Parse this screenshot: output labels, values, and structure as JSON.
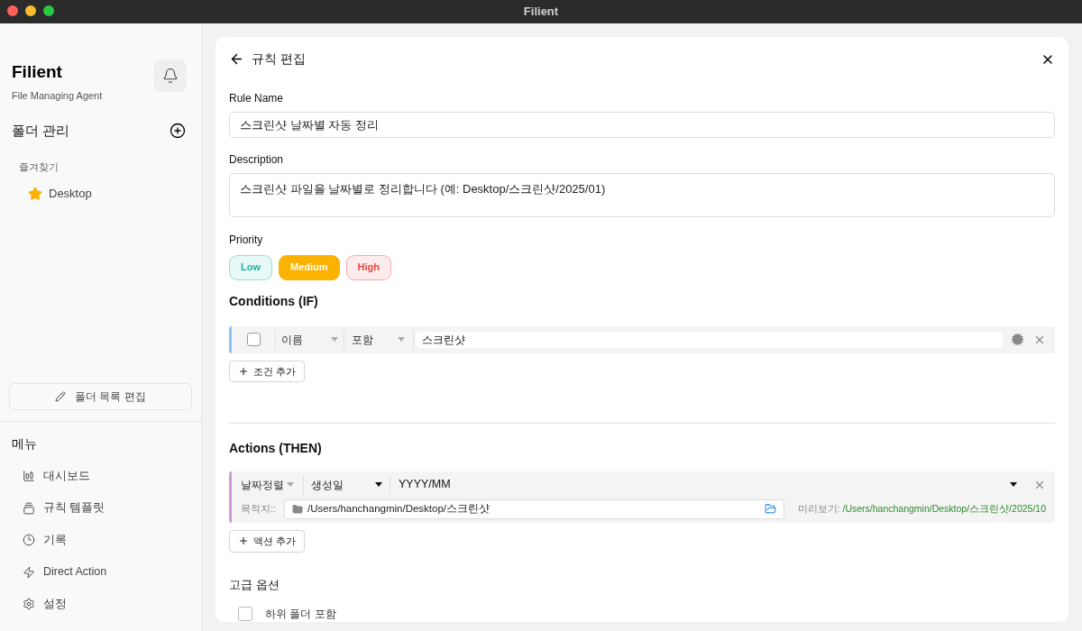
{
  "window": {
    "title": "Filient"
  },
  "sidebar": {
    "app_name": "Filient",
    "app_subtitle": "File Managing Agent",
    "folders_title": "폴더 관리",
    "favorites_title": "즐겨찾기",
    "favorites": [
      {
        "label": "Desktop"
      }
    ],
    "edit_button": "폴더 목록 편집",
    "menu_title": "메뉴",
    "menu": [
      {
        "kind": "dashboard",
        "label": "대시보드"
      },
      {
        "kind": "templates",
        "label": "규칙 템플릿"
      },
      {
        "kind": "history",
        "label": "기록"
      },
      {
        "kind": "action",
        "label": "Direct Action"
      },
      {
        "kind": "settings",
        "label": "설정"
      }
    ]
  },
  "editor": {
    "title": "규칙 편집",
    "rule_name_label": "Rule Name",
    "rule_name": "스크린샷 날짜별 자동 정리",
    "description_label": "Description",
    "description": "스크린샷 파일을 날짜별로 정리합니다 (예: Desktop/스크린샷/2025/01)",
    "priority_label": "Priority",
    "priorities": [
      {
        "label": "Low",
        "selected": false,
        "color": "#14b8a6"
      },
      {
        "label": "Medium",
        "selected": true,
        "color": "#fbb200"
      },
      {
        "label": "High",
        "selected": false,
        "color": "#ef4444"
      }
    ],
    "conditions_title": "Conditions (IF)",
    "conditions": [
      {
        "checked": false,
        "field": "이름",
        "operator": "포함",
        "value": "스크린샷"
      }
    ],
    "add_condition": "조건 추가",
    "actions_title": "Actions (THEN)",
    "actions": [
      {
        "type": "날짜정렬",
        "basis": "생성일",
        "format": "YYYY/MM",
        "destination_label": "목적지::",
        "destination": "/Users/hanchangmin/Desktop/스크린샷",
        "preview_label": "미리보기:",
        "preview": "/Users/hanchangmin/Desktop/스크린샷/2025/10"
      }
    ],
    "add_action": "액션 추가",
    "advanced_title": "고급 옵션",
    "advanced_options": [
      {
        "label": "하위 폴더 포함",
        "checked": false
      }
    ]
  }
}
